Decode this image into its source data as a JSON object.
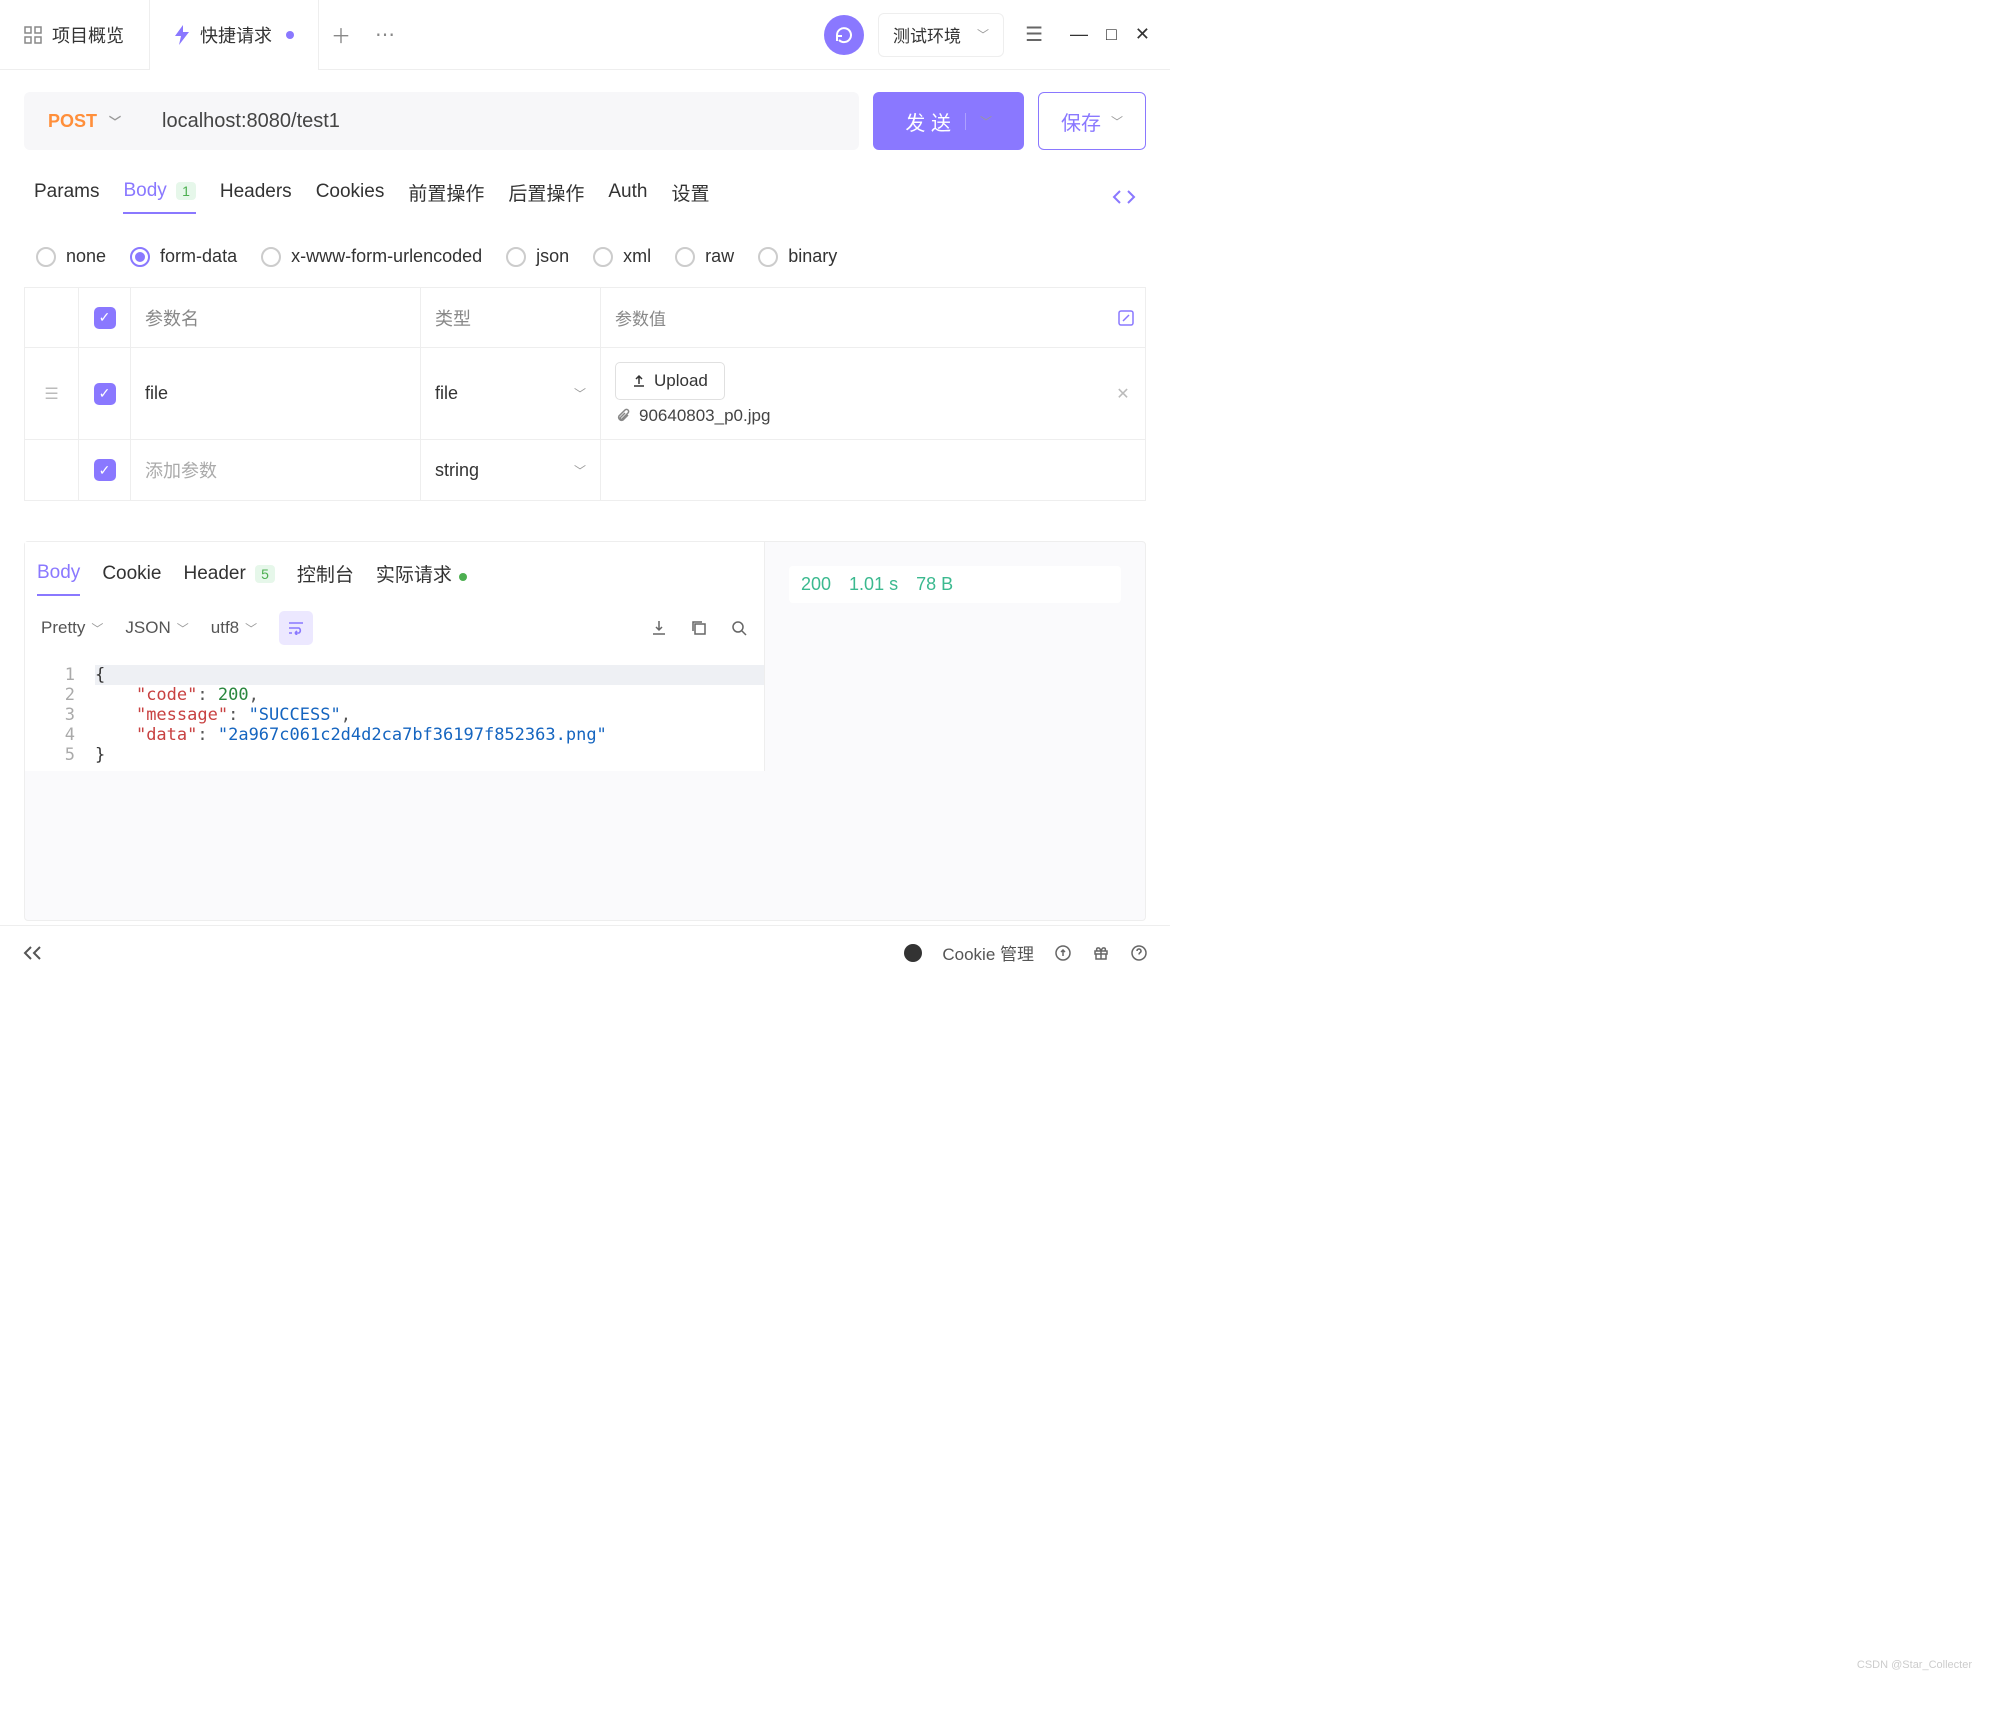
{
  "header": {
    "overview_tab": "项目概览",
    "quick_request_tab": "快捷请求",
    "env_label": "测试环境"
  },
  "request": {
    "method": "POST",
    "url": "localhost:8080/test1",
    "send_label": "发 送",
    "save_label": "保存"
  },
  "req_tabs": {
    "params": "Params",
    "body": "Body",
    "body_badge": "1",
    "headers": "Headers",
    "cookies": "Cookies",
    "pre": "前置操作",
    "post": "后置操作",
    "auth": "Auth",
    "settings": "设置"
  },
  "body_types": {
    "none": "none",
    "formdata": "form-data",
    "urlencoded": "x-www-form-urlencoded",
    "json": "json",
    "xml": "xml",
    "raw": "raw",
    "binary": "binary"
  },
  "param_table": {
    "h_name": "参数名",
    "h_type": "类型",
    "h_value": "参数值",
    "row1_name": "file",
    "row1_type": "file",
    "upload_label": "Upload",
    "row1_filename": "90640803_p0.jpg",
    "row2_placeholder": "添加参数",
    "row2_type": "string"
  },
  "response": {
    "tabs": {
      "body": "Body",
      "cookie": "Cookie",
      "header": "Header",
      "header_badge": "5",
      "console": "控制台",
      "actual": "实际请求"
    },
    "toolbar": {
      "pretty": "Pretty",
      "json": "JSON",
      "utf8": "utf8"
    },
    "status": "200",
    "time": "1.01 s",
    "size": "78 B",
    "code_lines": [
      {
        "no": "1",
        "raw": "{"
      },
      {
        "no": "2",
        "key": "\"code\"",
        "sep": ": ",
        "val": "200",
        "vtype": "num",
        "trail": ","
      },
      {
        "no": "3",
        "key": "\"message\"",
        "sep": ": ",
        "val": "\"SUCCESS\"",
        "vtype": "str",
        "trail": ","
      },
      {
        "no": "4",
        "key": "\"data\"",
        "sep": ": ",
        "val": "\"2a967c061c2d4d2ca7bf36197f852363.png\"",
        "vtype": "str",
        "trail": ""
      },
      {
        "no": "5",
        "raw": "}"
      }
    ]
  },
  "footer": {
    "cookie_mgmt": "Cookie 管理"
  },
  "watermark": "CSDN @Star_Collecter"
}
